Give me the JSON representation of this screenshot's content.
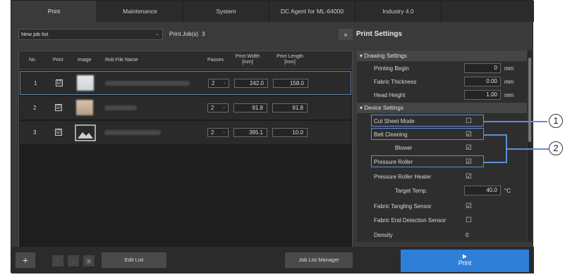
{
  "tabs": [
    {
      "label": "Print",
      "active": true
    },
    {
      "label": "Maintenance"
    },
    {
      "label": "System"
    },
    {
      "label": "DC Agent for ML-64000"
    },
    {
      "label": "Industry 4.0"
    }
  ],
  "joblist": {
    "dropdown_value": "New job list",
    "count_label": "Print Job(s)",
    "count_value": "3",
    "expand_icon": "»",
    "headers": {
      "no": "No",
      "print": "Print",
      "image": "Image",
      "file": "Rob File Name",
      "passes": "Passes",
      "width": "Print Width\n[mm]",
      "length": "Print Length\n[mm]"
    },
    "rows": [
      {
        "no": "1",
        "checked": "☑",
        "passes": "2",
        "width": "242.0",
        "length": "158.0"
      },
      {
        "no": "2",
        "checked": "☑",
        "passes": "2",
        "width": "91.8",
        "length": "91.8"
      },
      {
        "no": "3",
        "checked": "☑",
        "passes": "2",
        "width": "395.1",
        "length": "10.0"
      }
    ]
  },
  "bottom": {
    "add": "+",
    "edit_list": "Edit List",
    "job_list_manager": "Job List Manager",
    "print_icon": "▶",
    "print": "Print"
  },
  "settings": {
    "title": "Print Settings",
    "drawing_header": "Drawing Settings",
    "device_header": "Device Settings",
    "printing_begin": {
      "label": "Printing Begin",
      "value": "0",
      "unit": "mm"
    },
    "fabric_thickness": {
      "label": "Fabric Thickness",
      "value": "0.00",
      "unit": "mm"
    },
    "head_height": {
      "label": "Head Height",
      "value": "1.00",
      "unit": "mm"
    },
    "cut_sheet_mode": {
      "label": "Cut Sheet Mode",
      "mark": "☐"
    },
    "belt_cleaning": {
      "label": "Belt Cleaning",
      "mark": "☑"
    },
    "blower": {
      "label": "Blower",
      "mark": "☑"
    },
    "pressure_roller": {
      "label": "Pressure Roller",
      "mark": "☑"
    },
    "pressure_roller_heater": {
      "label": "Pressure Roller Heater",
      "mark": "☑"
    },
    "target_temp": {
      "label": "Target Temp.",
      "value": "40.0",
      "unit": "°C"
    },
    "fabric_tangling": {
      "label": "Fabric Tangling Sensor",
      "mark": "☑"
    },
    "fabric_end": {
      "label": "Fabric End Detection Sensor",
      "mark": "☐"
    },
    "density": {
      "label": "Density",
      "value": "0"
    }
  },
  "callouts": [
    "1",
    "2"
  ]
}
